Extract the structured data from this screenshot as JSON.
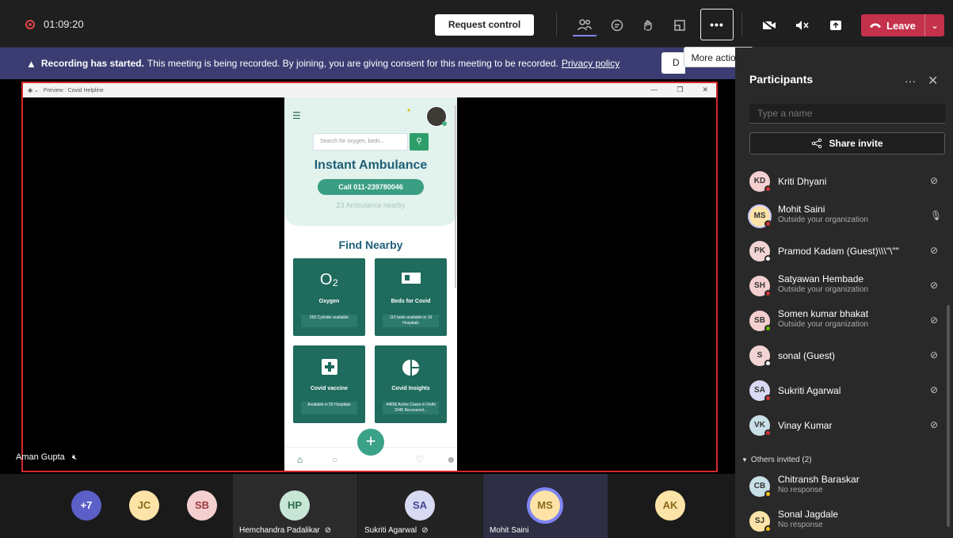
{
  "topbar": {
    "timer": "01:09:20",
    "request_control": "Request control",
    "more_glyph": "•••",
    "leave_label": "Leave",
    "tooltip": "More actions"
  },
  "banner": {
    "bold": "Recording has started.",
    "text": "This meeting is being recorded. By joining, you are giving consent for this meeting to be recorded.",
    "link": "Privacy policy",
    "button": "D"
  },
  "shared_window": {
    "title": "Preview : Covid Helpline",
    "search_placeholder": "Search for oxygen, beds...",
    "heading": "Instant Ambulance",
    "call_button": "Call 011-239780046",
    "nearby_count": "23 Ambulance nearby",
    "find_nearby": "Find Nearby",
    "cards": [
      {
        "name": "Oxygen",
        "sub": "256 Cylinder available",
        "icon": "O₂"
      },
      {
        "name": "Beds for Covid",
        "sub": "110 beds available in 10 Hospitals",
        "icon": "bed"
      },
      {
        "name": "Covid vaccine",
        "sub": "Available in 55 Hospitals",
        "icon": "plus"
      },
      {
        "name": "Covid Insights",
        "sub": "44656 Active Cases in Delhi 2045 Recovered...",
        "icon": "pie"
      }
    ]
  },
  "stage_name": "Aman Gupta",
  "panel": {
    "title": "Participants",
    "search_placeholder": "Type a name",
    "share_invite": "Share invite",
    "participants": [
      {
        "initials": "KD",
        "name": "Kriti Dhyani",
        "sub": "",
        "bg": "#f4cfd0",
        "status": "#d13438",
        "mic": "muted"
      },
      {
        "initials": "MS",
        "name": "Mohit Saini",
        "sub": "Outside your organization",
        "bg": "#fde3a7",
        "status": "#d13438",
        "mic": "on"
      },
      {
        "initials": "PK",
        "name": "Pramod Kadam (Guest)\\\\\\\"\\\"\"",
        "sub": "",
        "bg": "#f2d4d4",
        "status": "#ffffff",
        "mic": "muted"
      },
      {
        "initials": "SH",
        "name": "Satyawan Hembade",
        "sub": "Outside your organization",
        "bg": "#f4cfd0",
        "status": "#d13438",
        "mic": "muted"
      },
      {
        "initials": "SB",
        "name": "Somen kumar bhakat",
        "sub": "Outside your organization",
        "bg": "#f4cfd0",
        "status": "#6bb700",
        "mic": "muted"
      },
      {
        "initials": "S",
        "name": "sonal (Guest)",
        "sub": "",
        "bg": "#f2d4d4",
        "status": "#ffffff",
        "mic": "muted"
      },
      {
        "initials": "SA",
        "name": "Sukriti Agarwal",
        "sub": "",
        "bg": "#d8d9f2",
        "status": "#d13438",
        "mic": "muted"
      },
      {
        "initials": "VK",
        "name": "Vinay Kumar",
        "sub": "",
        "bg": "#c9dfe8",
        "status": "#d13438",
        "mic": "muted"
      }
    ],
    "others_label": "Others invited (2)",
    "others": [
      {
        "initials": "CB",
        "name": "Chitransh Baraskar",
        "sub": "No response",
        "bg": "#c9dfe8",
        "status": "#f8c21c"
      },
      {
        "initials": "SJ",
        "name": "Sonal Jagdale",
        "sub": "No response",
        "bg": "#fde3a7",
        "status": "#f8c21c"
      }
    ]
  },
  "gallery": [
    {
      "initials": "+7",
      "label": "",
      "bg": "#5b5fc7",
      "fg": "#ffffff"
    },
    {
      "initials": "JC",
      "label": "",
      "bg": "#fde3a7",
      "fg": "#8a6a1a"
    },
    {
      "initials": "SB",
      "label": "",
      "bg": "#f4cfd0",
      "fg": "#9c3a3e"
    },
    {
      "initials": "HP",
      "label": "Hemchandra Padalikar",
      "bg": "#c7e6d6",
      "fg": "#2e6b4a"
    },
    {
      "initials": "SA",
      "label": "Sukriti Agarwal",
      "bg": "#d8d9f2",
      "fg": "#444791"
    },
    {
      "initials": "MS",
      "label": "Mohit Saini",
      "bg": "#fde3a7",
      "fg": "#8a6a1a"
    },
    {
      "initials": "AK",
      "label": "",
      "bg": "#fde3a7",
      "fg": "#8a6a1a"
    }
  ]
}
